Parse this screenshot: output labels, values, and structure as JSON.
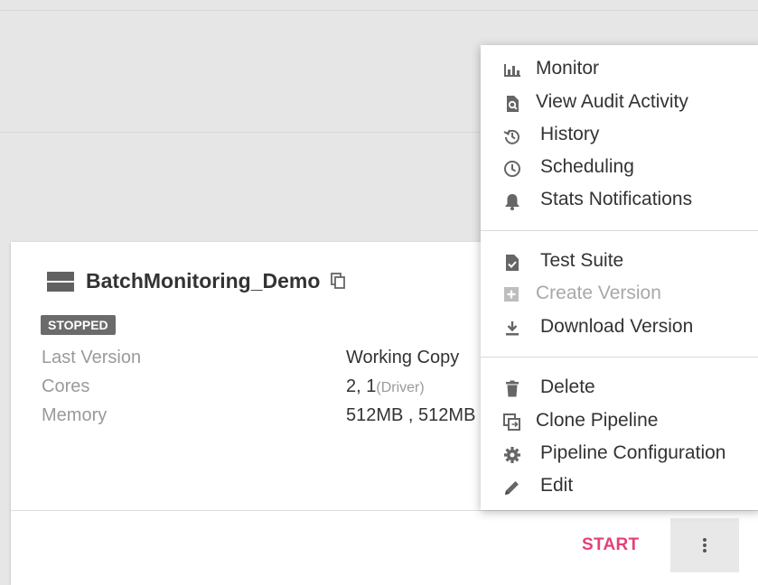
{
  "pipeline": {
    "title": "BatchMonitoring_Demo",
    "status": "STOPPED",
    "details": [
      {
        "label": "Last Version",
        "value": "Working Copy",
        "sub": ""
      },
      {
        "label": "Cores",
        "value": "2, 1",
        "sub": "(Driver)"
      },
      {
        "label": "Memory",
        "value": "512MB , 512MB",
        "sub": ""
      }
    ],
    "start_label": "START",
    "start_color": "#e5407a"
  },
  "menu": {
    "groups": [
      [
        {
          "label": "Monitor",
          "icon": "bar-chart-icon",
          "enabled": true
        },
        {
          "label": "View Audit Activity",
          "icon": "document-search-icon",
          "enabled": true
        },
        {
          "label": "History",
          "icon": "history-icon",
          "enabled": true
        },
        {
          "label": "Scheduling",
          "icon": "clock-icon",
          "enabled": true
        },
        {
          "label": "Stats Notifications",
          "icon": "bell-icon",
          "enabled": true
        }
      ],
      [
        {
          "label": "Test Suite",
          "icon": "file-check-icon",
          "enabled": true
        },
        {
          "label": "Create Version",
          "icon": "add-box-icon",
          "enabled": false
        },
        {
          "label": "Download Version",
          "icon": "download-icon",
          "enabled": true
        }
      ],
      [
        {
          "label": "Delete",
          "icon": "trash-icon",
          "enabled": true
        },
        {
          "label": "Clone Pipeline",
          "icon": "clone-icon",
          "enabled": true
        },
        {
          "label": "Pipeline Configuration",
          "icon": "gear-icon",
          "enabled": true
        },
        {
          "label": "Edit",
          "icon": "pencil-icon",
          "enabled": true
        }
      ]
    ]
  }
}
